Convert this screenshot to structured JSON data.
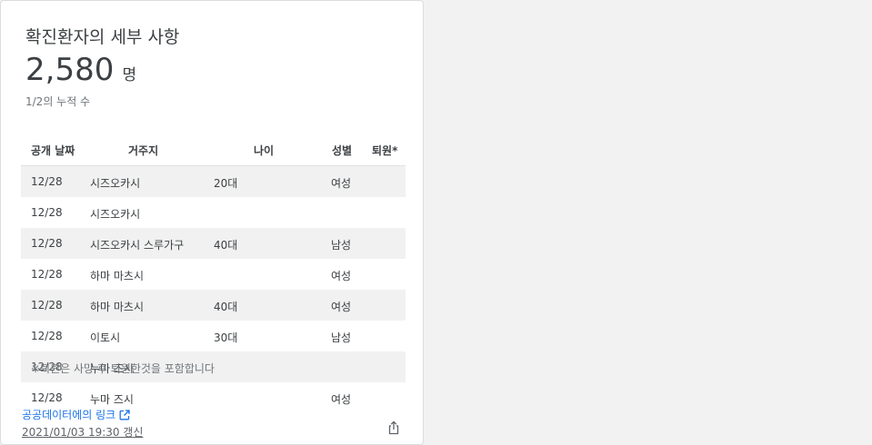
{
  "card": {
    "title": "확진환자의 세부 사항",
    "count": "2,580",
    "count_unit": "명",
    "subtitle": "1/2의 누적 수"
  },
  "table": {
    "headers": {
      "date": "공개 날짜",
      "residence": "거주지",
      "age": "나이",
      "gender": "성별",
      "discharged": "퇴원*"
    },
    "rows": [
      {
        "date": "12/28",
        "residence": "시즈오카시",
        "age": "20대",
        "gender": "여성"
      },
      {
        "date": "12/28",
        "residence": "시즈오카시",
        "age": "",
        "gender": ""
      },
      {
        "date": "12/28",
        "residence": "시즈오카시 스루가구",
        "age": "40대",
        "gender": "남성"
      },
      {
        "date": "12/28",
        "residence": "하마 마츠시",
        "age": "",
        "gender": "여성"
      },
      {
        "date": "12/28",
        "residence": "하마 마츠시",
        "age": "40대",
        "gender": "여성"
      },
      {
        "date": "12/28",
        "residence": "이토시",
        "age": "30대",
        "gender": "남성"
      },
      {
        "date": "12/28",
        "residence": "누마 즈시",
        "age": "",
        "gender": ""
      },
      {
        "date": "12/28",
        "residence": "누마 즈시",
        "age": "",
        "gender": "여성"
      }
    ],
    "footnote": "※퇴원은 사망 후 퇴원한것을 포함합니다"
  },
  "footer": {
    "link_label": "공공데이터에의 링크",
    "updated": "2021/01/03 19:30 갱신"
  },
  "icons": {
    "external_link": "external-link-icon",
    "share": "share-icon"
  },
  "colors": {
    "link": "#1a73e8",
    "row_shade": "#f1f1f1"
  }
}
